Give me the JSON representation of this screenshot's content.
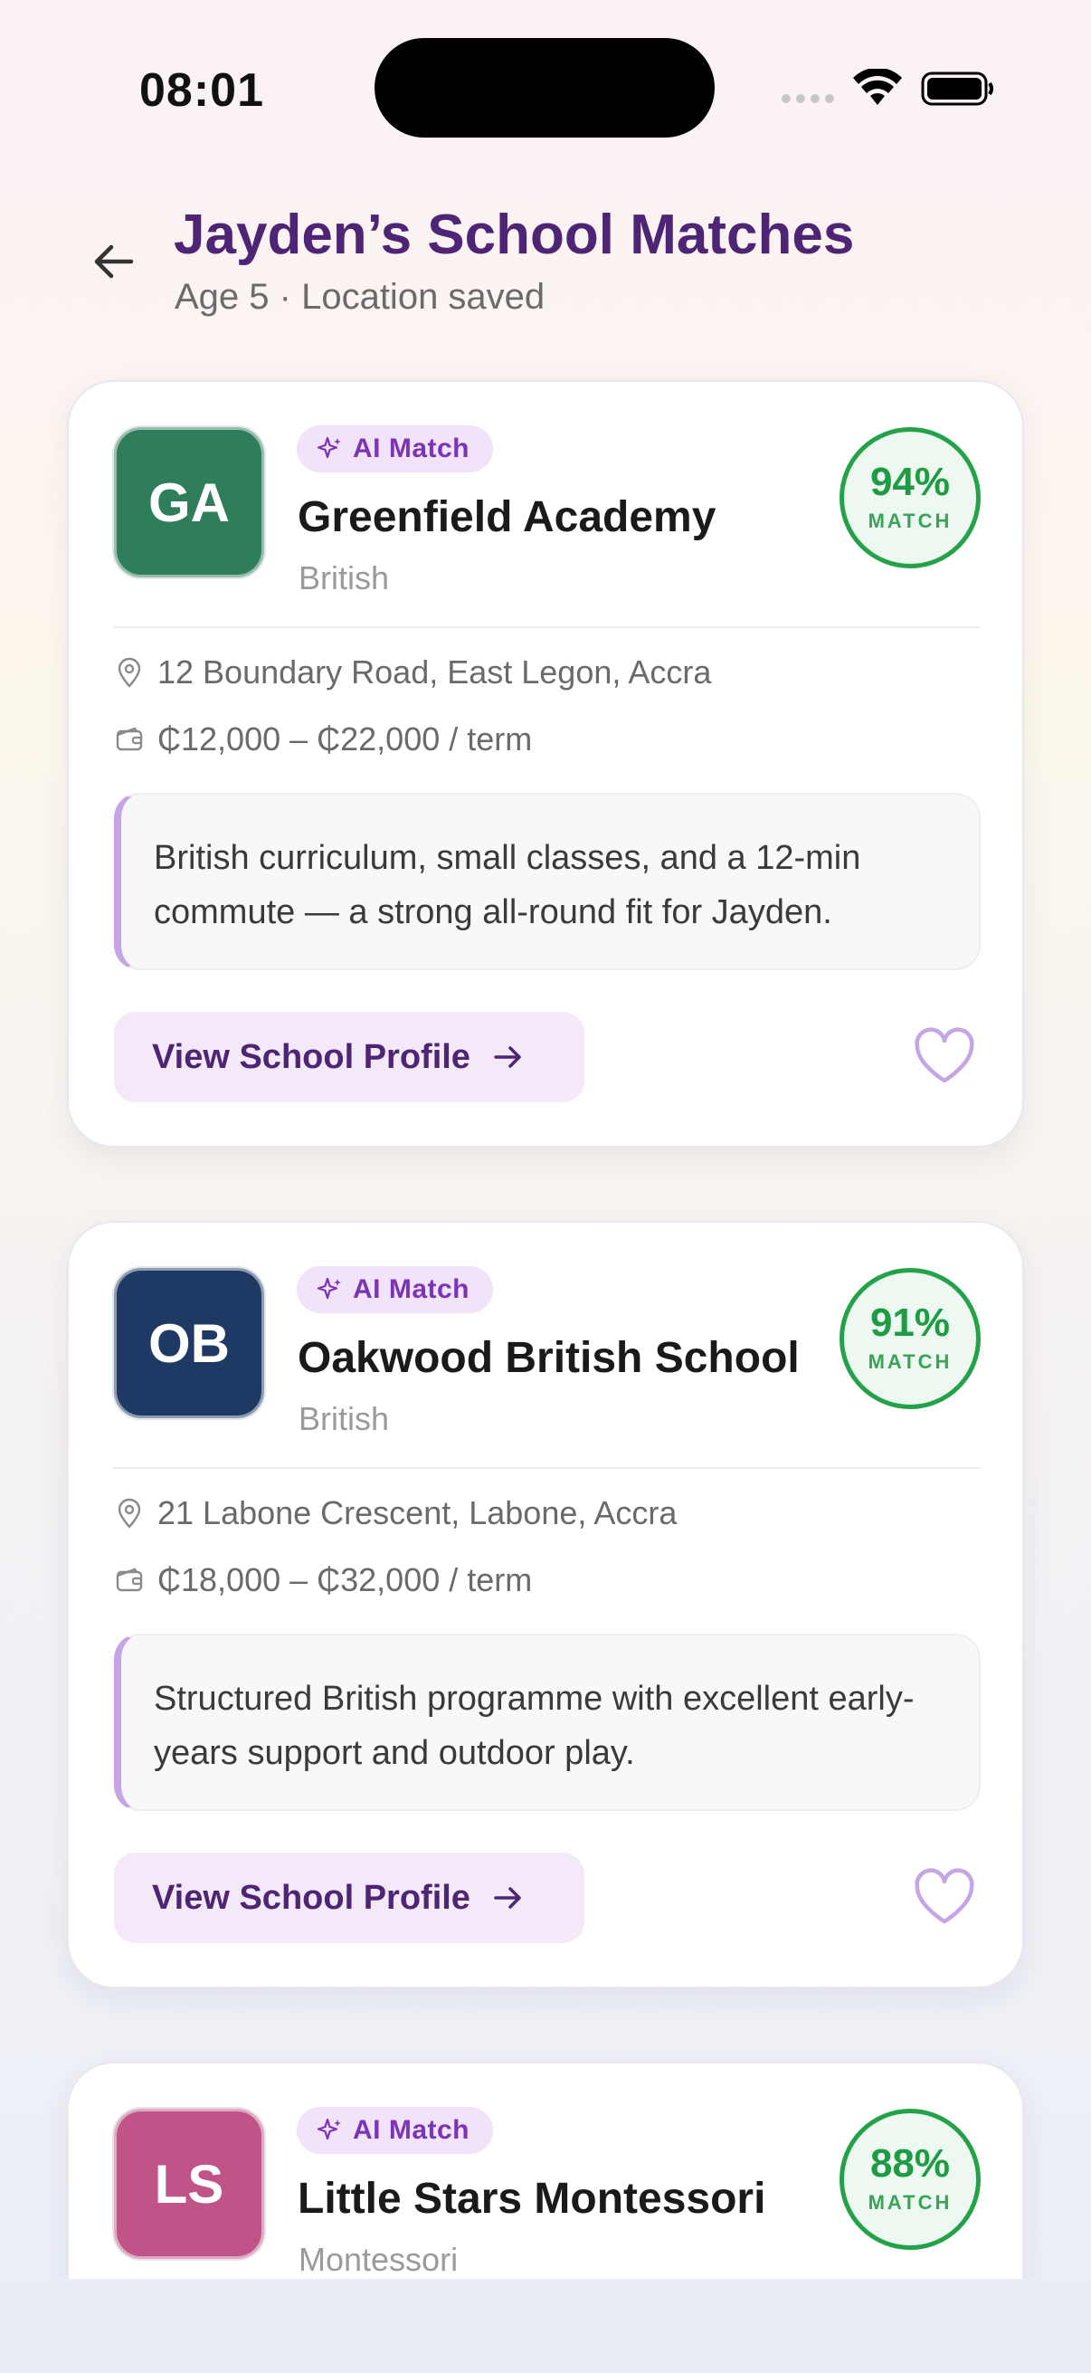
{
  "status_bar": {
    "time": "08:01"
  },
  "header": {
    "title": "Jayden’s School Matches",
    "subtitle": "Age 5 · Location saved"
  },
  "colors": {
    "title": "#4e2475",
    "match_green": "#1f9a45",
    "ai_badge_bg": "#f1e3f9",
    "accent_purple": "#7b34b5"
  },
  "schools": [
    {
      "initials": "GA",
      "avatar_color": "#2e7d5b",
      "badge": "AI Match",
      "name": "Greenfield Academy",
      "curriculum": "British",
      "match_percent": "94%",
      "match_label": "MATCH",
      "address": "12 Boundary Road, East Legon, Accra",
      "fees": "₵12,000 – ₵22,000 / term",
      "reason": "British curriculum, small classes, and a 12-min commute — a strong all-round fit for Jayden.",
      "button_label": "View School Profile"
    },
    {
      "initials": "OB",
      "avatar_color": "#1e3a64",
      "badge": "AI Match",
      "name": "Oakwood British School",
      "curriculum": "British",
      "match_percent": "91%",
      "match_label": "MATCH",
      "address": "21 Labone Crescent, Labone, Accra",
      "fees": "₵18,000 – ₵32,000 / term",
      "reason": "Structured British programme with excellent early-years support and outdoor play.",
      "button_label": "View School Profile"
    },
    {
      "initials": "LS",
      "avatar_color": "#c05488",
      "badge": "AI Match",
      "name": "Little Stars Montessori",
      "curriculum": "Montessori",
      "match_percent": "88%",
      "match_label": "MATCH"
    }
  ],
  "icons": {
    "back": "arrow-left-icon",
    "sparkle": "sparkle-icon",
    "location": "map-pin-icon",
    "fees": "wallet-icon",
    "arrow": "arrow-right-icon",
    "favorite": "heart-icon"
  }
}
